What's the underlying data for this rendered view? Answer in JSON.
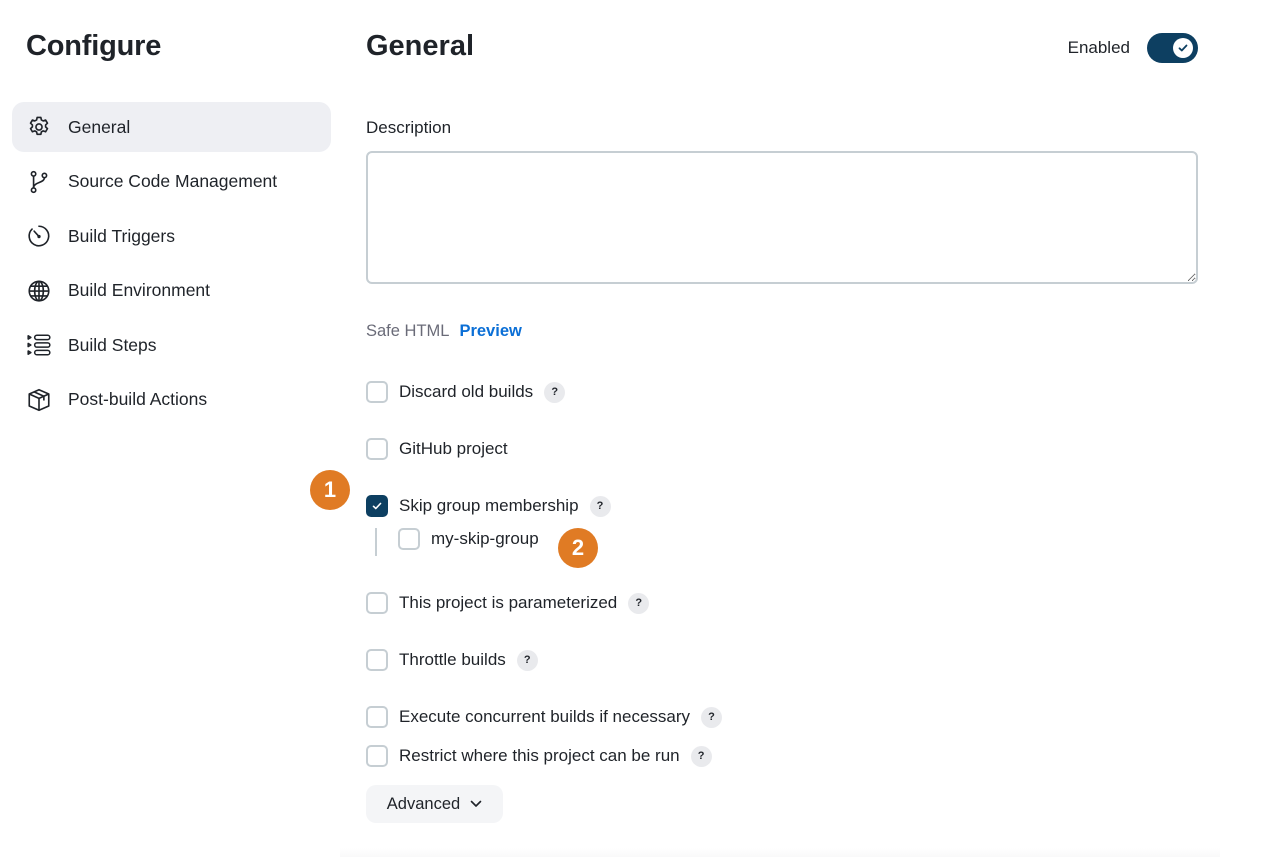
{
  "sidebar": {
    "title": "Configure",
    "items": [
      {
        "label": "General",
        "icon": "gear-icon",
        "active": true
      },
      {
        "label": "Source Code Management",
        "icon": "git-branch-icon",
        "active": false
      },
      {
        "label": "Build Triggers",
        "icon": "timer-icon",
        "active": false
      },
      {
        "label": "Build Environment",
        "icon": "globe-icon",
        "active": false
      },
      {
        "label": "Build Steps",
        "icon": "list-steps-icon",
        "active": false
      },
      {
        "label": "Post-build Actions",
        "icon": "package-icon",
        "active": false
      }
    ]
  },
  "main": {
    "title": "General",
    "enabled": {
      "label": "Enabled",
      "value": true
    },
    "description": {
      "label": "Description",
      "value": "",
      "placeholder": ""
    },
    "safe_html": {
      "label": "Safe HTML",
      "preview_label": "Preview"
    },
    "options": [
      {
        "label": "Discard old builds",
        "checked": false,
        "help": "?"
      },
      {
        "label": "GitHub project",
        "checked": false,
        "help": null
      },
      {
        "label": "Skip group membership",
        "checked": true,
        "help": "?",
        "sub_options": [
          {
            "label": "my-skip-group",
            "checked": false
          }
        ]
      },
      {
        "label": "This project is parameterized",
        "checked": false,
        "help": "?"
      },
      {
        "label": "Throttle builds",
        "checked": false,
        "help": "?"
      },
      {
        "label": "Execute concurrent builds if necessary",
        "checked": false,
        "help": "?"
      },
      {
        "label": "Restrict where this project can be run",
        "checked": false,
        "help": "?"
      }
    ],
    "advanced_label": "Advanced"
  },
  "annotations": [
    {
      "label": "1"
    },
    {
      "label": "2"
    }
  ],
  "colors": {
    "accent": "#0d3f61",
    "link": "#0b6fd6",
    "annotation": "#e07b24",
    "sidebar_active_bg": "#eeeff3"
  }
}
